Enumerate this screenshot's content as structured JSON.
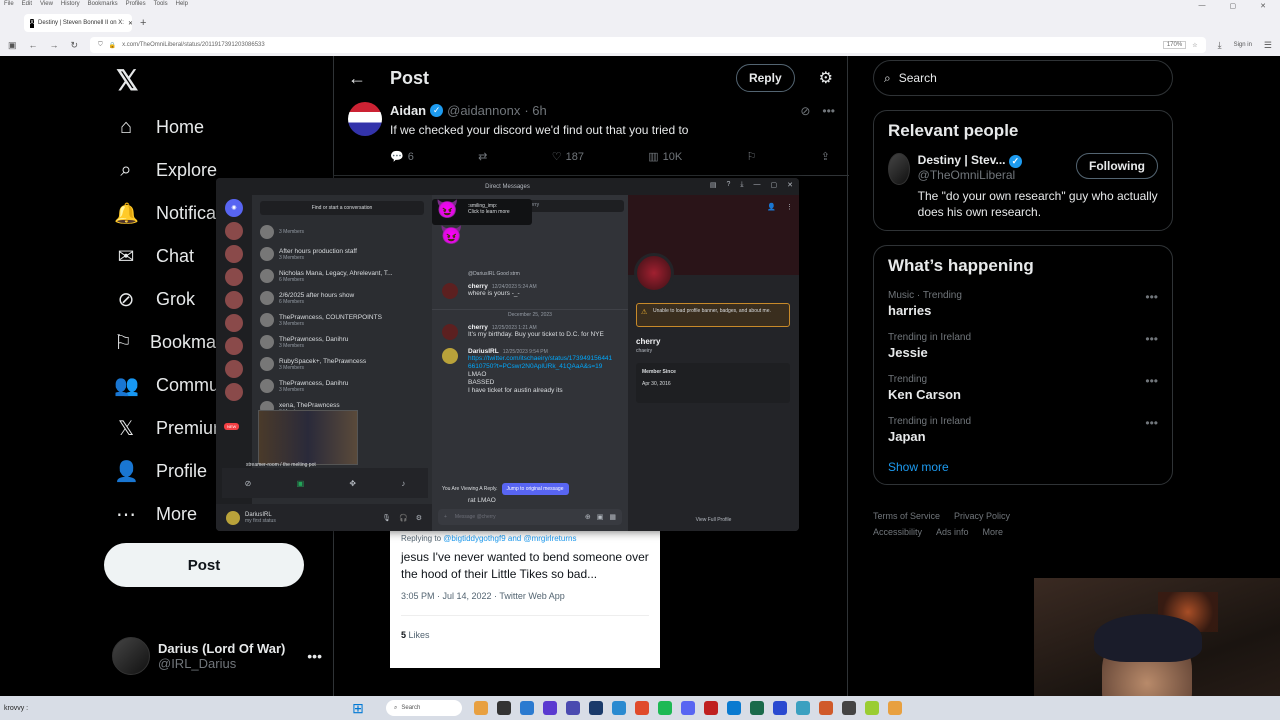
{
  "browser": {
    "menu": [
      "File",
      "Edit",
      "View",
      "History",
      "Bookmarks",
      "Profiles",
      "Tools",
      "Help"
    ],
    "tab_title": "Destiny | Steven Bonnell II on X:",
    "url": "x.com/TheOmniLiberal/status/2011917391203086533",
    "zoom": "170%",
    "signin": "Sign in"
  },
  "nav": {
    "items": [
      "Home",
      "Explore",
      "Notifications",
      "Chat",
      "Grok",
      "Bookmarks",
      "Communities",
      "Premium",
      "Profile",
      "More"
    ],
    "post_button": "Post",
    "account_name": "Darius (Lord Of War)",
    "account_handle": "@IRL_Darius"
  },
  "header": {
    "title": "Post",
    "reply_button": "Reply"
  },
  "tweet": {
    "name": "Aidan",
    "handle": "@aidannonx",
    "time": "· 6h",
    "text": "If we checked your discord we'd find out that you tried to",
    "replies": "6",
    "likes": "187",
    "views": "10K"
  },
  "quoted": {
    "replying_to": "Replying to",
    "mentions": "@bigtiddygothgf9 and @mrgirlreturns",
    "text": "jesus I've never wanted to bend someone over the hood of their Little Tikes so bad...",
    "meta": "3:05 PM · Jul 14, 2022 · Twitter Web App",
    "likes_count": "5",
    "likes_label": "Likes"
  },
  "right": {
    "search_placeholder": "Search",
    "relevant_title": "Relevant people",
    "person_name": "Destiny | Stev...",
    "person_handle": "@TheOmniLiberal",
    "following_button": "Following",
    "person_bio": "The \"do your own research\" guy who actually does his own research.",
    "happening_title": "What’s happening",
    "trends": [
      {
        "meta": "Music · Trending",
        "name": "harries"
      },
      {
        "meta": "Trending in Ireland",
        "name": "Jessie"
      },
      {
        "meta": "Trending",
        "name": "Ken Carson"
      },
      {
        "meta": "Trending in Ireland",
        "name": "Japan"
      }
    ],
    "show_more": "Show more",
    "footer": [
      "Terms of Service",
      "Privacy Policy",
      "Accessibility",
      "Ads info",
      "More"
    ]
  },
  "discord": {
    "window_title": "Direct Messages",
    "find_conversation": "Find or start a conversation",
    "dms": [
      {
        "name": "",
        "sub": "3 Members"
      },
      {
        "name": "After hours production staff",
        "sub": "3 Members"
      },
      {
        "name": "Nicholas Mana, Legacy, Ahrelevant, T...",
        "sub": "6 Members"
      },
      {
        "name": "2/6/2025 after hours show",
        "sub": "6 Members"
      },
      {
        "name": "ThePrawncess, COUNTERPOINTS",
        "sub": "3 Members"
      },
      {
        "name": "ThePrawncess, Danihru",
        "sub": "3 Members"
      },
      {
        "name": "RubySpacek+, ThePrawncess",
        "sub": "3 Members"
      },
      {
        "name": "ThePrawncess, Danihru",
        "sub": "3 Members"
      },
      {
        "name": "xena, ThePrawncess",
        "sub": "3 Members"
      }
    ],
    "new_badge": "NEW",
    "user_name": "DariusIRL",
    "user_status": "my first status",
    "stream_caption": "streamer-room / the melting pot",
    "emoji_tip_name": ":smiling_imp:",
    "emoji_tip_sub": "Click to learn more",
    "search_placeholder": "Search cherry",
    "reply_preview": "@DariusIRL Good strm",
    "msg1_author": "cherry",
    "msg1_time": "12/24/2023 5:24 AM",
    "msg1_text": "where is yours -_-",
    "date_divider": "December 25, 2023",
    "msg2_author": "cherry",
    "msg2_time": "12/25/2023 1:21 AM",
    "msg2_text": "It's my birthday. Buy your ticket to D.C. for NYE",
    "msg3_author": "DariusIRL",
    "msg3_time": "12/25/2023 9:54 PM",
    "msg3_link": "https://twitter.com/itschaeiry/status/1739491564416610750?t=PCswr2N0AplURk_41QAaA&s=19",
    "msg3_lines": [
      "LMAO",
      "BASSED",
      "I have ticket for austin already its"
    ],
    "msg3_tail": "rat LMAO",
    "viewing_reply": "You Are Viewing A Reply.",
    "jump_button": "Jump to original message",
    "message_placeholder": "Message @cherry",
    "profile_warning": "Unable to load profile banner, badges, and about me.",
    "profile_name": "cherry",
    "profile_handle": "chaeiry",
    "member_since_label": "Member Since",
    "member_since": "Apr 30, 2016",
    "view_full_profile": "View Full Profile"
  },
  "taskbar": {
    "user": "krovvy :",
    "search": "Search"
  },
  "colors": {
    "x_bg": "#000000",
    "x_blue": "#1d9bf0",
    "discord_bg": "#313338",
    "discord_blurple": "#5865f2"
  }
}
